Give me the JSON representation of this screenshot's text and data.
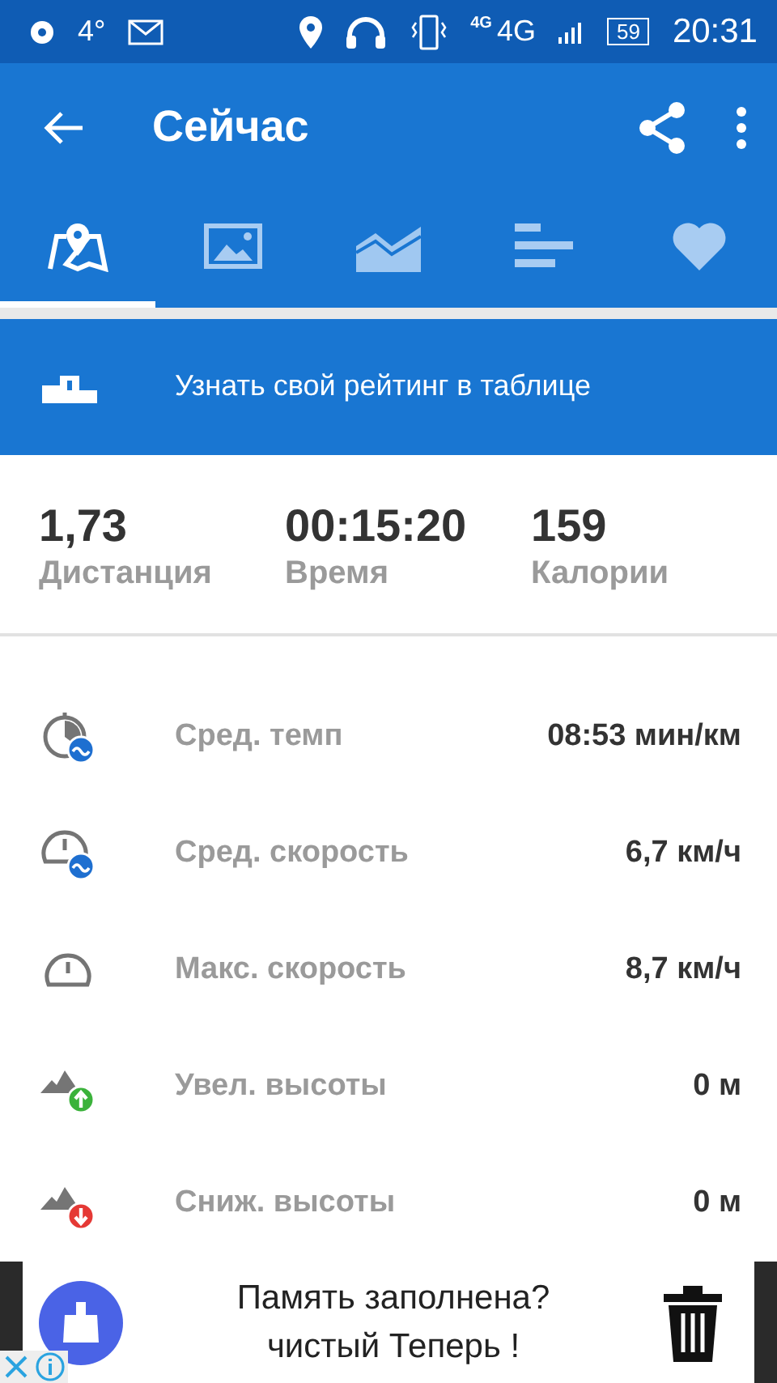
{
  "status_bar": {
    "temperature": "4°",
    "network_small": "4G",
    "network": "4G",
    "battery": "59",
    "time": "20:31"
  },
  "app_bar": {
    "title": "Сейчас"
  },
  "tabs": [
    {
      "kind": "map",
      "selected": true
    },
    {
      "kind": "photo",
      "selected": false
    },
    {
      "kind": "chart",
      "selected": false
    },
    {
      "kind": "bars",
      "selected": false
    },
    {
      "kind": "heart",
      "selected": false
    }
  ],
  "banner": {
    "text": "Узнать свой рейтинг в таблице"
  },
  "summary": [
    {
      "value": "1,73",
      "label": "Дистанция"
    },
    {
      "value": "00:15:20",
      "label": "Время"
    },
    {
      "value": "159",
      "label": "Калории"
    }
  ],
  "metrics": [
    {
      "kind": "pace",
      "label": "Сред. темп",
      "value": "08:53 мин/км"
    },
    {
      "kind": "avg-speed",
      "label": "Сред. скорость",
      "value": "6,7 км/ч"
    },
    {
      "kind": "max-speed",
      "label": "Макс. скорость",
      "value": "8,7 км/ч"
    },
    {
      "kind": "ascent",
      "label": "Увел. высоты",
      "value": "0 м"
    },
    {
      "kind": "descent",
      "label": "Сниж. высоты",
      "value": "0 м"
    }
  ],
  "ad": {
    "text": "Память заполнена? чистый Теперь !"
  }
}
